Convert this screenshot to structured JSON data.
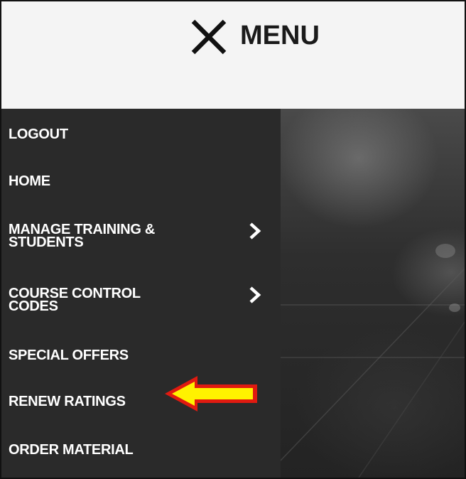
{
  "header": {
    "menu_label": "MENU",
    "close_icon": "close-x-icon"
  },
  "sidebar": {
    "items": [
      {
        "line1": "LOGOUT",
        "line2": "",
        "has_submenu": false
      },
      {
        "line1": "HOME",
        "line2": "",
        "has_submenu": false
      },
      {
        "line1": "MANAGE TRAINING &",
        "line2": "STUDENTS",
        "has_submenu": true
      },
      {
        "line1": "COURSE CONTROL",
        "line2": "CODES",
        "has_submenu": true
      },
      {
        "line1": "SPECIAL OFFERS",
        "line2": "",
        "has_submenu": false
      },
      {
        "line1": "RENEW RATINGS",
        "line2": "",
        "has_submenu": false
      },
      {
        "line1": "ORDER MATERIAL",
        "line2": "",
        "has_submenu": false
      }
    ]
  },
  "annotation": {
    "icon": "arrow-left-icon",
    "fill": "#fff200",
    "stroke": "#e01a10"
  },
  "colors": {
    "header_bg": "#f4f4f4",
    "sidebar_bg": "#2a2a2a",
    "text": "#ffffff"
  }
}
